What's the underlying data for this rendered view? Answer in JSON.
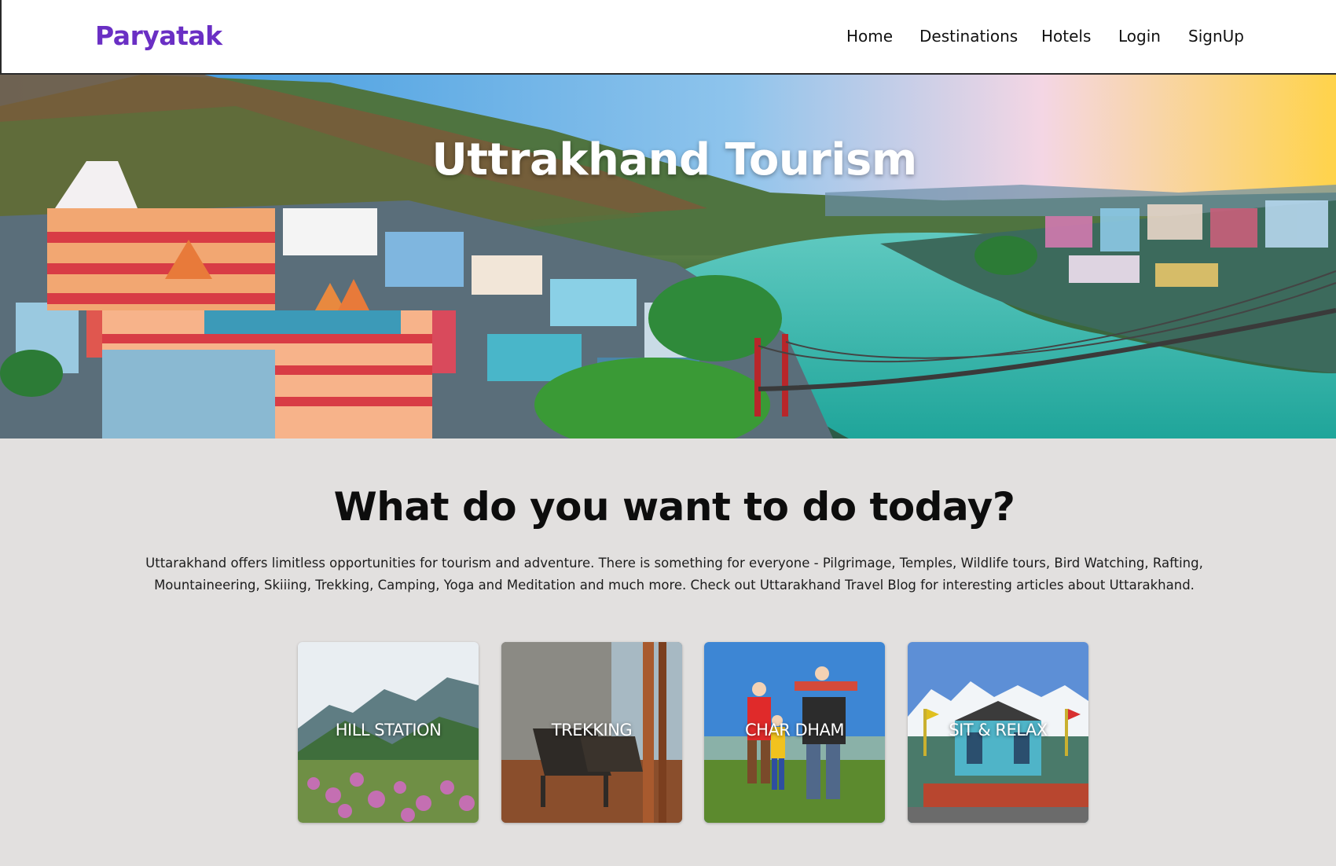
{
  "navbar": {
    "brand": "Paryatak",
    "links": [
      "Home",
      "Destinations",
      "Hotels",
      "Login",
      "SignUp"
    ]
  },
  "hero": {
    "title": "Uttrakhand Tourism"
  },
  "main": {
    "title": "What do you want to do today?",
    "description": "Uttarakhand offers limitless opportunities for tourism and adventure. There is something for everyone - Pilgrimage, Temples, Wildlife tours, Bird Watching, Rafting, Mountaineering, Skiiing, Trekking, Camping, Yoga and Meditation and much more. Check out Uttarakhand Travel Blog for interesting articles about Uttarakhand.",
    "cards": [
      {
        "label": "HILL STATION"
      },
      {
        "label": "TREKKING"
      },
      {
        "label": "CHAR DHAM"
      },
      {
        "label": "SIT & RELAX"
      }
    ]
  },
  "colors": {
    "brand": "#6a2fc4",
    "page_background": "#e2e0df",
    "nav_background": "#ffffff"
  }
}
